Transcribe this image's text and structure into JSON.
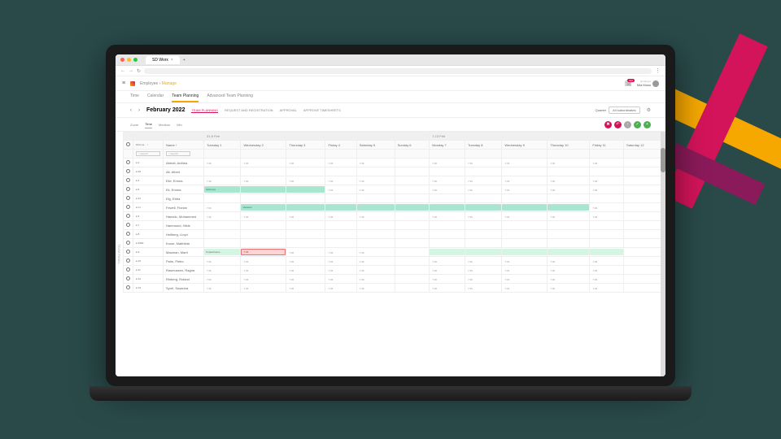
{
  "browser": {
    "tab_title": "SD Worx"
  },
  "header": {
    "breadcrumb_parent": "Employee",
    "breadcrumb_current": "Manage",
    "notif_count": "112",
    "user_role": "Employer",
    "user_name": "Mia Moss"
  },
  "nav": {
    "time": "Time",
    "calendar": "Calendar",
    "team": "Team Planning",
    "adv": "Advanced Team Planning"
  },
  "toolbar": {
    "title": "February 2022",
    "tabs": {
      "plan": "TEAM PLANNING",
      "req": "REQUEST AND REGISTRATION",
      "appr": "APPROVAL",
      "ts": "APPROVE TIMESHEETS"
    },
    "quarter_lbl": "Quarter",
    "quarter_val": "All subordinates"
  },
  "filters": {
    "zoom": "Zoom",
    "time": "Time",
    "medium": "Medium",
    "min": "Min"
  },
  "grid": {
    "side_label": "TEAM PANEL",
    "first_col": "First na…",
    "name_col": "Name",
    "week1": "31-6 Feb",
    "week2": "7-13 Feb",
    "days": [
      "Tuesday 1",
      "Wednesday 2",
      "Thursday 3",
      "Friday 4",
      "Saturday 5",
      "Sunday 6",
      "Monday 7",
      "Tuesday 8",
      "Wednesday 9",
      "Thursday 10",
      "Friday 11",
      "Saturday 12"
    ],
    "search_ph": "Search",
    "rows": [
      {
        "st": "● 2",
        "nm": "Abbott, Anthea",
        "h": "7:36"
      },
      {
        "st": "● 20",
        "nm": "Alt, Albert",
        "h": ""
      },
      {
        "st": "● 4",
        "nm": "Eile, Emma",
        "h": "7:36"
      },
      {
        "st": "● 5",
        "nm": "Ek, Emma",
        "h": "7:36",
        "bar1": "Sickness"
      },
      {
        "st": "● 24",
        "nm": "Elg, Ebba",
        "h": ""
      },
      {
        "st": "● Cr…",
        "nm": "Fewell, Florian",
        "h": "7:36",
        "bar2": "Vacation"
      },
      {
        "st": "● 6",
        "nm": "Hamido, Mohammed",
        "h": "7:36"
      },
      {
        "st": "● 7",
        "nm": "Hammond, Hilde",
        "h": ""
      },
      {
        "st": "● 8",
        "nm": "Hellberg, Lloyd",
        "h": ""
      },
      {
        "st": "● 4500",
        "nm": "Kruse, Matthilda",
        "h": ""
      },
      {
        "st": "● 9",
        "nm": "Maaman, Marit",
        "h": "7:36",
        "bar3": "Unpaid leave"
      },
      {
        "st": "● 10",
        "nm": "Palm, Pietro",
        "h": "7:36"
      },
      {
        "st": "● 11",
        "nm": "Rasmussen, Ragna",
        "h": "7:36"
      },
      {
        "st": "● 12",
        "nm": "Rhiberg, Roland",
        "h": "7:36"
      },
      {
        "st": "● 13",
        "nm": "Syrel, Susanna",
        "h": "7:36"
      }
    ]
  }
}
